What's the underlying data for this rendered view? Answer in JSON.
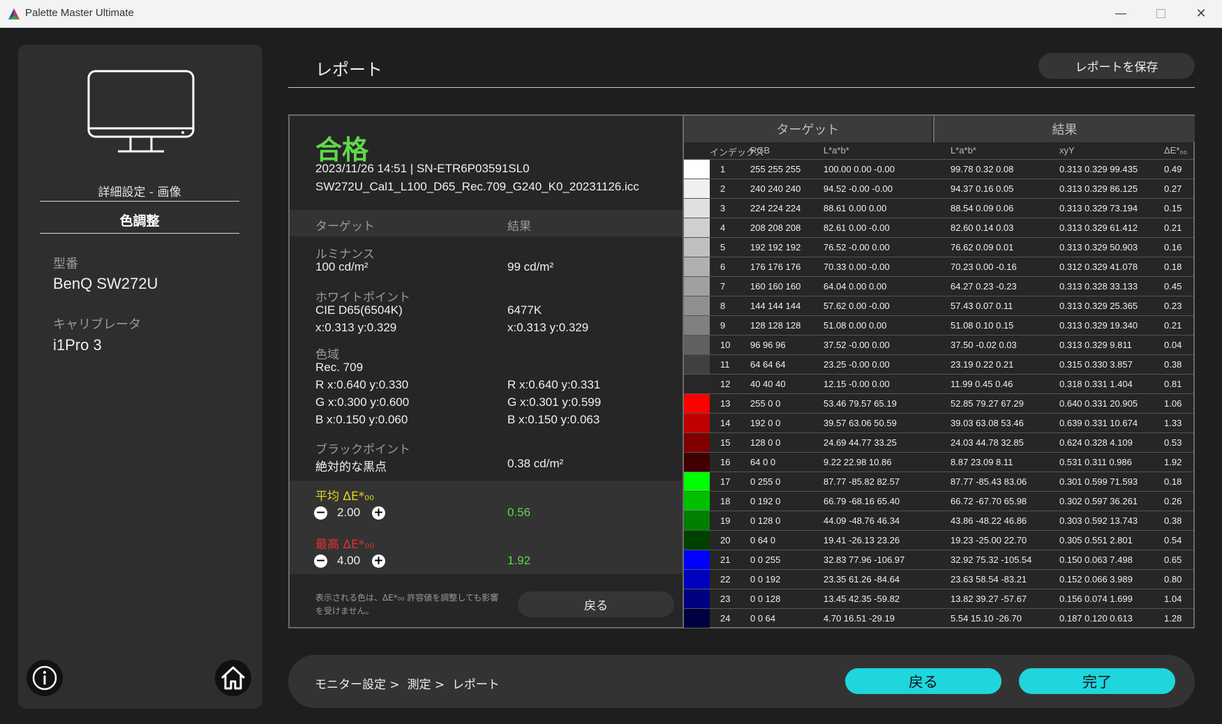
{
  "window": {
    "title": "Palette Master Ultimate"
  },
  "sidebar": {
    "detail_label": "詳細設定 - 画像",
    "active_label": "色調整",
    "model_label": "型番",
    "model_value": "BenQ SW272U",
    "calibrator_label": "キャリブレータ",
    "calibrator_value": "i1Pro 3"
  },
  "header": {
    "title": "レポート",
    "save_button": "レポートを保存"
  },
  "report": {
    "status": "合格",
    "date_serial": "2023/11/26 14:51 | SN-ETR6P03591SL0",
    "profile": "SW272U_Cal1_L100_D65_Rec.709_G240_K0_20231126.icc",
    "col_target": "ターゲット",
    "col_result": "結果",
    "luminance_label": "ルミナンス",
    "luminance_target": "100 cd/m²",
    "luminance_result": "99 cd/m²",
    "whitepoint_label": "ホワイトポイント",
    "whitepoint_target": "CIE D65(6504K)",
    "whitepoint_target_xy": "x:0.313 y:0.329",
    "whitepoint_result": "6477K",
    "whitepoint_result_xy": "x:0.313 y:0.329",
    "gamut_label": "色域",
    "gamut_target": "Rec. 709",
    "gamut_target_r": "R x:0.640 y:0.330",
    "gamut_target_g": "G x:0.300 y:0.600",
    "gamut_target_b": "B x:0.150 y:0.060",
    "gamut_result_r": "R x:0.640 y:0.331",
    "gamut_result_g": "G x:0.301 y:0.599",
    "gamut_result_b": "B x:0.150 y:0.063",
    "blackpoint_label": "ブラックポイント",
    "blackpoint_target": "絶対的な黒点",
    "blackpoint_result": "0.38 cd/m²",
    "avg_de_label": "平均 ΔE*₀₀",
    "avg_de_tolerance": "2.00",
    "avg_de_result": "0.56",
    "max_de_label": "最高 ΔE*₀₀",
    "max_de_tolerance": "4.00",
    "max_de_result": "1.92",
    "note": "表示される色は、ΔE*₀₀ 許容値を調整しても影響を受けません。",
    "back_button": "戻る"
  },
  "table": {
    "group_target": "ターゲット",
    "group_result": "結果",
    "columns": [
      "インデックス",
      "RGB",
      "L*a*b*",
      "L*a*b*",
      "xyY",
      "ΔE*₀₀"
    ],
    "rows": [
      {
        "color": "#ffffff",
        "index": "1",
        "rgb": "255 255 255",
        "target_lab": "100.00 0.00 -0.00",
        "result_lab": "99.78 0.32 0.08",
        "xyy": "0.313 0.329 99.435",
        "de": "0.49"
      },
      {
        "color": "#f0f0f0",
        "index": "2",
        "rgb": "240 240 240",
        "target_lab": "94.52 -0.00 -0.00",
        "result_lab": "94.37 0.16 0.05",
        "xyy": "0.313 0.329 86.125",
        "de": "0.27"
      },
      {
        "color": "#e0e0e0",
        "index": "3",
        "rgb": "224 224 224",
        "target_lab": "88.61 0.00 0.00",
        "result_lab": "88.54 0.09 0.06",
        "xyy": "0.313 0.329 73.194",
        "de": "0.15"
      },
      {
        "color": "#d0d0d0",
        "index": "4",
        "rgb": "208 208 208",
        "target_lab": "82.61 0.00 -0.00",
        "result_lab": "82.60 0.14 0.03",
        "xyy": "0.313 0.329 61.412",
        "de": "0.21"
      },
      {
        "color": "#c0c0c0",
        "index": "5",
        "rgb": "192 192 192",
        "target_lab": "76.52 -0.00 0.00",
        "result_lab": "76.62 0.09 0.01",
        "xyy": "0.313 0.329 50.903",
        "de": "0.16"
      },
      {
        "color": "#b0b0b0",
        "index": "6",
        "rgb": "176 176 176",
        "target_lab": "70.33 0.00 -0.00",
        "result_lab": "70.23 0.00 -0.16",
        "xyy": "0.312 0.329 41.078",
        "de": "0.18"
      },
      {
        "color": "#a0a0a0",
        "index": "7",
        "rgb": "160 160 160",
        "target_lab": "64.04 0.00 0.00",
        "result_lab": "64.27 0.23 -0.23",
        "xyy": "0.313 0.328 33.133",
        "de": "0.45"
      },
      {
        "color": "#909090",
        "index": "8",
        "rgb": "144 144 144",
        "target_lab": "57.62 0.00 -0.00",
        "result_lab": "57.43 0.07 0.11",
        "xyy": "0.313 0.329 25.365",
        "de": "0.23"
      },
      {
        "color": "#808080",
        "index": "9",
        "rgb": "128 128 128",
        "target_lab": "51.08 0.00 0.00",
        "result_lab": "51.08 0.10 0.15",
        "xyy": "0.313 0.329 19.340",
        "de": "0.21"
      },
      {
        "color": "#606060",
        "index": "10",
        "rgb": "96 96 96",
        "target_lab": "37.52 -0.00 0.00",
        "result_lab": "37.50 -0.02 0.03",
        "xyy": "0.313 0.329 9.811",
        "de": "0.04"
      },
      {
        "color": "#404040",
        "index": "11",
        "rgb": "64 64 64",
        "target_lab": "23.25 -0.00 0.00",
        "result_lab": "23.19 0.22 0.21",
        "xyy": "0.315 0.330 3.857",
        "de": "0.38"
      },
      {
        "color": "#282828",
        "index": "12",
        "rgb": "40 40 40",
        "target_lab": "12.15 -0.00 0.00",
        "result_lab": "11.99 0.45 0.46",
        "xyy": "0.318 0.331 1.404",
        "de": "0.81"
      },
      {
        "color": "#ff0000",
        "index": "13",
        "rgb": "255 0 0",
        "target_lab": "53.46 79.57 65.19",
        "result_lab": "52.85 79.27 67.29",
        "xyy": "0.640 0.331 20.905",
        "de": "1.06"
      },
      {
        "color": "#c00000",
        "index": "14",
        "rgb": "192 0 0",
        "target_lab": "39.57 63.06 50.59",
        "result_lab": "39.03 63.08 53.46",
        "xyy": "0.639 0.331 10.674",
        "de": "1.33"
      },
      {
        "color": "#800000",
        "index": "15",
        "rgb": "128 0 0",
        "target_lab": "24.69 44.77 33.25",
        "result_lab": "24.03 44.78 32.85",
        "xyy": "0.624 0.328 4.109",
        "de": "0.53"
      },
      {
        "color": "#400000",
        "index": "16",
        "rgb": "64 0 0",
        "target_lab": "9.22 22.98 10.86",
        "result_lab": "8.87 23.09 8.11",
        "xyy": "0.531 0.311 0.986",
        "de": "1.92"
      },
      {
        "color": "#00ff00",
        "index": "17",
        "rgb": "0 255 0",
        "target_lab": "87.77 -85.82 82.57",
        "result_lab": "87.77 -85.43 83.06",
        "xyy": "0.301 0.599 71.593",
        "de": "0.18"
      },
      {
        "color": "#00c000",
        "index": "18",
        "rgb": "0 192 0",
        "target_lab": "66.79 -68.16 65.40",
        "result_lab": "66.72 -67.70 65.98",
        "xyy": "0.302 0.597 36.261",
        "de": "0.26"
      },
      {
        "color": "#008000",
        "index": "19",
        "rgb": "0 128 0",
        "target_lab": "44.09 -48.76 46.34",
        "result_lab": "43.86 -48.22 46.86",
        "xyy": "0.303 0.592 13.743",
        "de": "0.38"
      },
      {
        "color": "#004000",
        "index": "20",
        "rgb": "0 64 0",
        "target_lab": "19.41 -26.13 23.26",
        "result_lab": "19.23 -25.00 22.70",
        "xyy": "0.305 0.551 2.801",
        "de": "0.54"
      },
      {
        "color": "#0000ff",
        "index": "21",
        "rgb": "0 0 255",
        "target_lab": "32.83 77.96 -106.97",
        "result_lab": "32.92 75.32 -105.54",
        "xyy": "0.150 0.063 7.498",
        "de": "0.65"
      },
      {
        "color": "#0000c0",
        "index": "22",
        "rgb": "0 0 192",
        "target_lab": "23.35 61.26 -84.64",
        "result_lab": "23.63 58.54 -83.21",
        "xyy": "0.152 0.066 3.989",
        "de": "0.80"
      },
      {
        "color": "#000080",
        "index": "23",
        "rgb": "0 0 128",
        "target_lab": "13.45 42.35 -59.82",
        "result_lab": "13.82 39.27 -57.67",
        "xyy": "0.156 0.074 1.699",
        "de": "1.04"
      },
      {
        "color": "#000040",
        "index": "24",
        "rgb": "0 0 64",
        "target_lab": "4.70 16.51 -29.19",
        "result_lab": "5.54 15.10 -26.70",
        "xyy": "0.187 0.120 0.613",
        "de": "1.28"
      }
    ]
  },
  "footer": {
    "breadcrumb": [
      "モニター設定 >",
      "測定 >",
      "レポート"
    ],
    "back_button": "戻る",
    "done_button": "完了"
  },
  "colors": {
    "pass_green": "#5fd84a",
    "accent_cyan": "#1fd6dc",
    "avg_yellow": "#e8d21a",
    "max_red": "#e03030"
  },
  "icons": [
    "app-logo-icon",
    "minimize-icon",
    "maximize-icon",
    "close-icon",
    "monitor-icon",
    "minus-icon",
    "plus-icon",
    "info-icon",
    "home-icon"
  ]
}
